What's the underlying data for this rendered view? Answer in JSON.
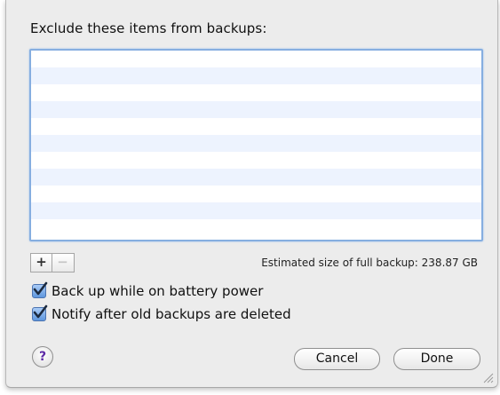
{
  "dialog": {
    "title": "Exclude these items from backups:",
    "list_rows": 11,
    "add_label": "+",
    "remove_label": "−",
    "estimate": "Estimated size of full backup: 238.87 GB",
    "options": [
      {
        "label": "Back up while on battery power",
        "checked": true
      },
      {
        "label": "Notify after old backups are deleted",
        "checked": true
      }
    ],
    "help_label": "?",
    "cancel_label": "Cancel",
    "done_label": "Done"
  },
  "colors": {
    "accent": "#86aee0",
    "stripe": "#edf3fe",
    "background": "#ececec"
  }
}
